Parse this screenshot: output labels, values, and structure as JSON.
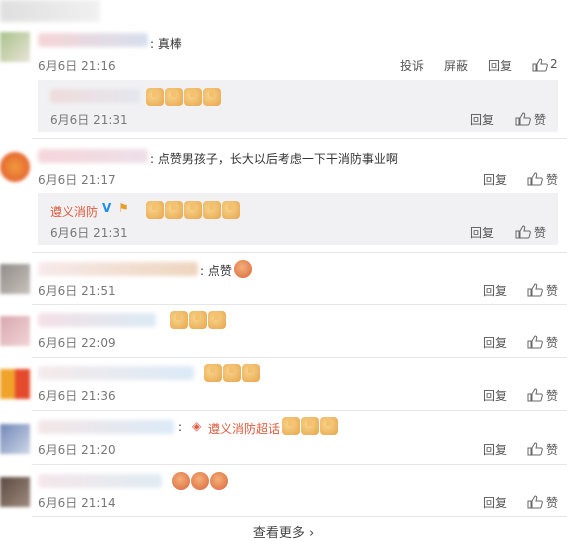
{
  "comments": [
    {
      "text": "真棒",
      "time": "6月6日 21:16",
      "report": "投诉",
      "block": "屏蔽",
      "reply": "回复",
      "like_count": "2",
      "replies": [
        {
          "time": "6月6日 21:31",
          "reply": "回复",
          "like": "赞"
        }
      ]
    },
    {
      "text": "点赞男孩子，长大以后考虑一下干消防事业啊",
      "time": "6月6日 21:17",
      "reply": "回复",
      "like": "赞",
      "replies": [
        {
          "name": "遵义消防",
          "time": "6月6日 21:31",
          "reply": "回复",
          "like": "赞"
        }
      ]
    },
    {
      "text": "点赞",
      "time": "6月6日 21:51",
      "reply": "回复",
      "like": "赞"
    },
    {
      "time": "6月6日 22:09",
      "reply": "回复",
      "like": "赞"
    },
    {
      "time": "6月6日 21:36",
      "reply": "回复",
      "like": "赞"
    },
    {
      "mention": "遵义消防超话",
      "time": "6月6日 21:20",
      "reply": "回复",
      "like": "赞"
    },
    {
      "time": "6月6日 21:14",
      "reply": "回复",
      "like": "赞"
    }
  ],
  "load_more": "查看更多 ›",
  "colors": {
    "accent": "#e05a3b",
    "verified": "#1a8ee8"
  }
}
